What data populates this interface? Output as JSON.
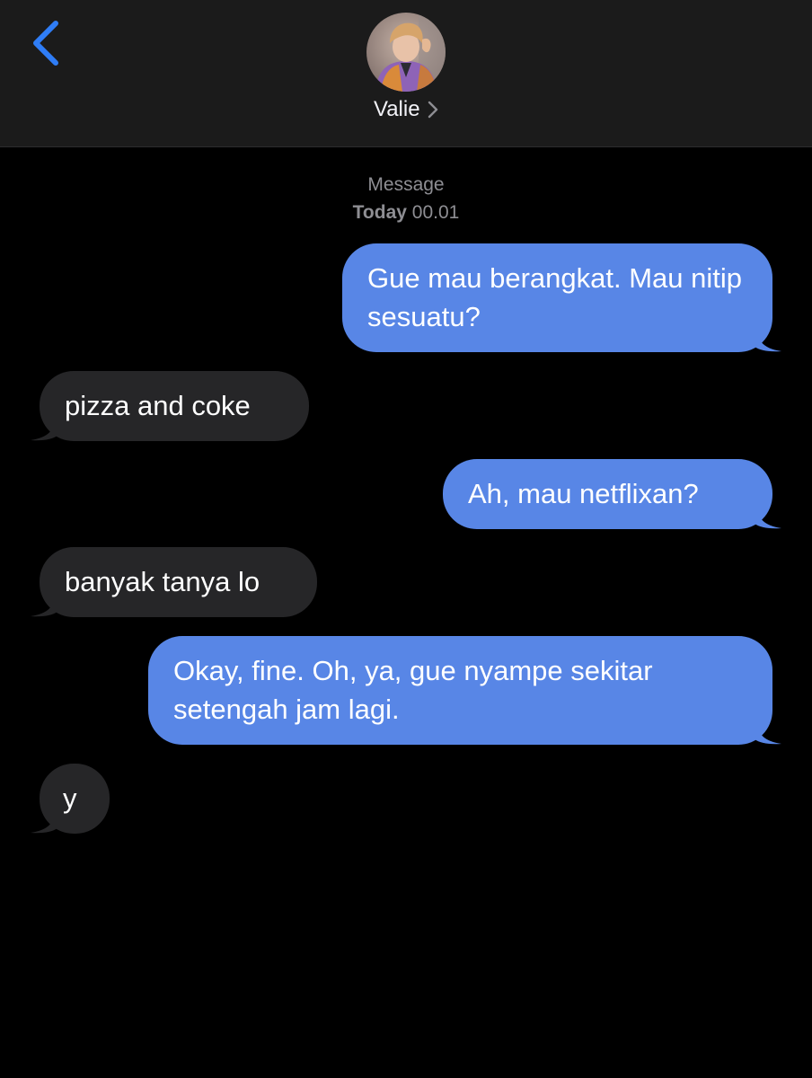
{
  "header": {
    "back_icon": "chevron-left-icon",
    "contact_name": "Valie",
    "contact_chevron_icon": "chevron-right-icon",
    "avatar_icon": "contact-avatar-photo"
  },
  "thread": {
    "service_label": "Message",
    "date_label": "Today",
    "time_label": "00.01"
  },
  "messages": [
    {
      "direction": "sent",
      "text": "Gue mau berangkat. Mau nitip sesuatu?"
    },
    {
      "direction": "received",
      "text": "pizza and coke"
    },
    {
      "direction": "sent",
      "text": "Ah, mau netflixan?"
    },
    {
      "direction": "received",
      "text": "banyak tanya lo"
    },
    {
      "direction": "sent",
      "text": "Okay, fine. Oh, ya, gue nyampe sekitar setengah jam lagi."
    },
    {
      "direction": "received",
      "text": "y"
    }
  ],
  "colors": {
    "background": "#000000",
    "header_background": "#1b1b1b",
    "sent_bubble": "#5886e6",
    "received_bubble": "#262628",
    "accent_blue": "#2f7df6",
    "secondary_text": "#8e8e93"
  }
}
